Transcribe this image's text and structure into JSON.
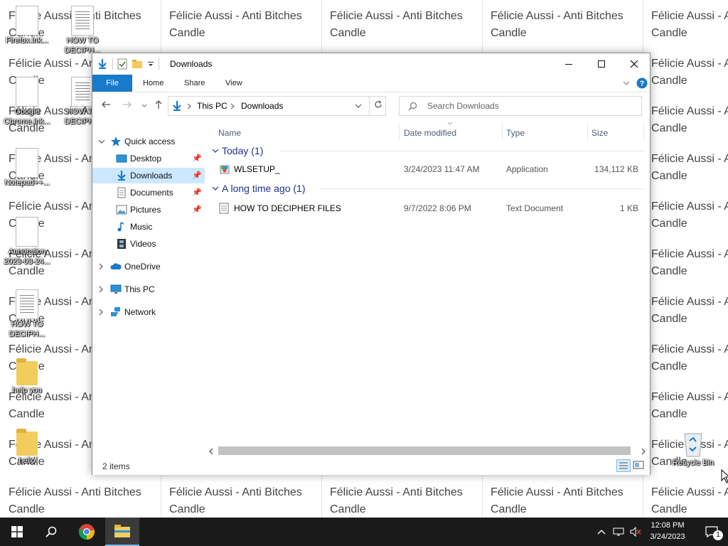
{
  "wallpaper": {
    "tile_text": "Félicie Aussi - Anti Bitches Candle"
  },
  "desktop": {
    "icons": [
      {
        "label": "Firefox.lnk..."
      },
      {
        "label": "HOW TO DECIPH..."
      },
      {
        "label": "Google Chrome.lnk..."
      },
      {
        "label": "HOW TO DECIPH..."
      },
      {
        "label": "Notepad++..."
      },
      {
        "label": "Annotation 2023-03-24..."
      },
      {
        "label": "HOW TO DECIPH..."
      },
      {
        "label": "help you"
      },
      {
        "label": "hello"
      },
      {
        "label": "Recycle Bin"
      }
    ]
  },
  "explorer": {
    "title": "Downloads",
    "ribbon_tabs": [
      "File",
      "Home",
      "Share",
      "View"
    ],
    "breadcrumb": [
      "This PC",
      "Downloads"
    ],
    "search_placeholder": "Search Downloads",
    "nav": {
      "quick_access": "Quick access",
      "items": [
        "Desktop",
        "Downloads",
        "Documents",
        "Pictures",
        "Music",
        "Videos"
      ],
      "onedrive": "OneDrive",
      "this_pc": "This PC",
      "network": "Network"
    },
    "columns": [
      "Name",
      "Date modified",
      "Type",
      "Size"
    ],
    "groups": [
      {
        "label": "Today (1)",
        "files": [
          {
            "name": "WLSETUP_",
            "date": "3/24/2023 11:47 AM",
            "type": "Application",
            "size": "134,112 KB"
          }
        ]
      },
      {
        "label": "A long time ago (1)",
        "files": [
          {
            "name": "HOW TO DECIPHER FILES",
            "date": "9/7/2022 8:06 PM",
            "type": "Text Document",
            "size": "1 KB"
          }
        ]
      }
    ],
    "status": "2 items"
  },
  "taskbar": {
    "time": "12:08 PM",
    "date": "3/24/2023",
    "notification_count": "1"
  },
  "colors": {
    "accent": "#1979ca",
    "selection": "#cce8ff",
    "group_header": "#1e3287",
    "taskbar": "#1a1a1a"
  }
}
